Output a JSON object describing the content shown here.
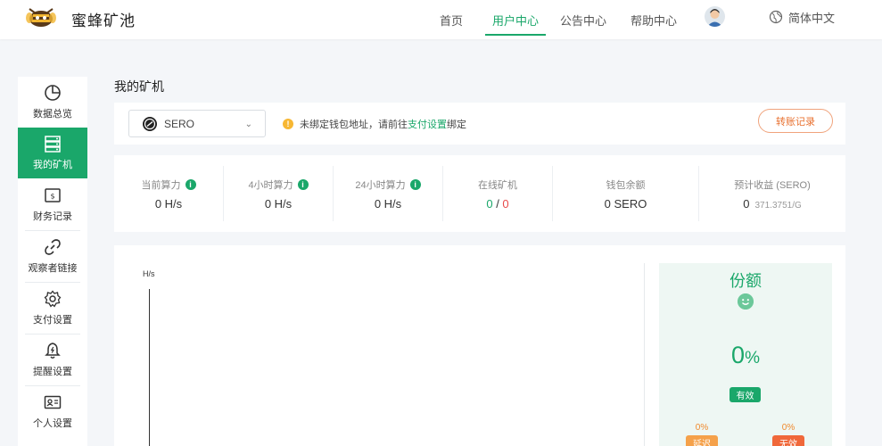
{
  "header": {
    "brand": "蜜蜂矿池",
    "nav": [
      "首页",
      "用户中心",
      "公告中心",
      "帮助中心"
    ],
    "language": "简体中文"
  },
  "sidebar": {
    "items": [
      {
        "label": "数据总览",
        "icon": "pie-chart-icon"
      },
      {
        "label": "我的矿机",
        "icon": "server-icon",
        "active": true
      },
      {
        "label": "财务记录",
        "icon": "bill-icon"
      },
      {
        "label": "观察者链接",
        "icon": "link-icon"
      },
      {
        "label": "支付设置",
        "icon": "gear-icon"
      },
      {
        "label": "提醒设置",
        "icon": "bell-icon"
      },
      {
        "label": "个人设置",
        "icon": "id-card-icon"
      }
    ]
  },
  "main": {
    "title": "我的矿机",
    "coin_select": "SERO",
    "warning": {
      "prefix": "未绑定钱包地址，请前往",
      "link": "支付设置",
      "suffix": "绑定"
    },
    "transfer_button": "转账记录",
    "stats": [
      {
        "label": "当前算力",
        "value": "0 H/s",
        "info": true
      },
      {
        "label": "4小时算力",
        "value": "0 H/s",
        "info": true
      },
      {
        "label": "24小时算力",
        "value": "0 H/s",
        "info": true
      },
      {
        "label": "在线矿机",
        "online": "0",
        "sep": " / ",
        "offline": "0"
      },
      {
        "label": "钱包余额",
        "value": "0 SERO"
      },
      {
        "label": "预计收益 (SERO)",
        "value": "0",
        "sub": "371.3751/G"
      }
    ],
    "chart": {
      "ylabel": "H/s"
    },
    "share": {
      "title": "份额",
      "percent": "0",
      "unit": "%",
      "status": "有效",
      "left_pct": "0%",
      "left_label": "延迟",
      "right_pct": "0%",
      "right_label": "无效"
    }
  },
  "colors": {
    "accent": "#1aa76a",
    "warning": "#f7b733",
    "danger": "#e84b4b",
    "orange": "#f08a2e"
  }
}
